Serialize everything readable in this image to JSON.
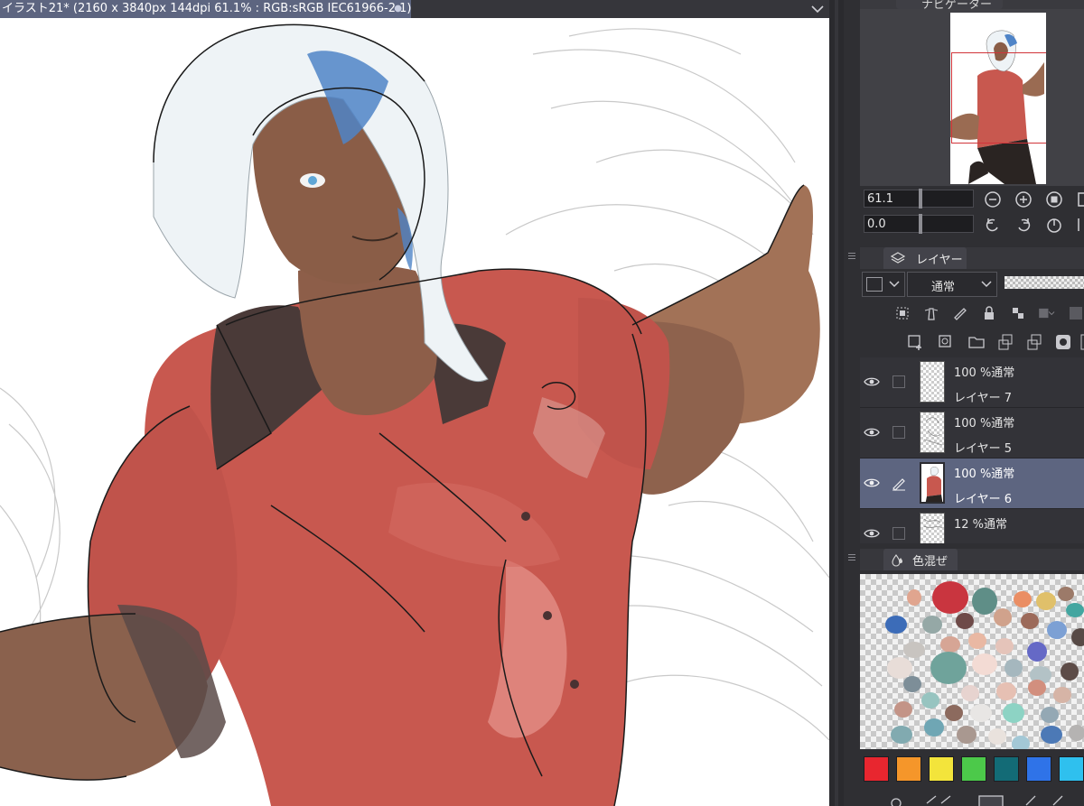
{
  "document": {
    "tab_title": "イラスト21* (2160 x 3840px 144dpi 61.1% : RGB:sRGB IEC61966-2.1)",
    "modified_dot": "●"
  },
  "navigator": {
    "tab_label": "ナビゲーター",
    "zoom_value": "61.1",
    "rotation_value": "0.0"
  },
  "layer_panel": {
    "tab_label": "レイヤー",
    "blend_mode": "通常",
    "layers": [
      {
        "opacity_mode": "100 %通常",
        "name": "レイヤー 7",
        "selected": false,
        "visible": true
      },
      {
        "opacity_mode": "100 %通常",
        "name": "レイヤー 5",
        "selected": false,
        "visible": true
      },
      {
        "opacity_mode": "100 %通常",
        "name": "レイヤー 6",
        "selected": true,
        "visible": true
      },
      {
        "opacity_mode": "12 %通常",
        "name": "",
        "selected": false,
        "visible": true
      }
    ]
  },
  "color_mix": {
    "tab_label": "色混ぜ",
    "palette": [
      "#e8262f",
      "#f5962a",
      "#f3e43b",
      "#4cc94a",
      "#136b76",
      "#2f73e8",
      "#2fc0ee"
    ]
  },
  "colors": {
    "accent": "#5d6580",
    "shirt": "#c8584f",
    "skin": "#9a6b52",
    "hair": "#eef3f6",
    "hair_accent": "#4f84c7",
    "collar": "#4a3a38"
  },
  "icons": {
    "tab_menu": "chevron-down-icon",
    "navigator": "navigator-icon",
    "layer": "layers-icon",
    "color_mix": "droplets-icon"
  }
}
